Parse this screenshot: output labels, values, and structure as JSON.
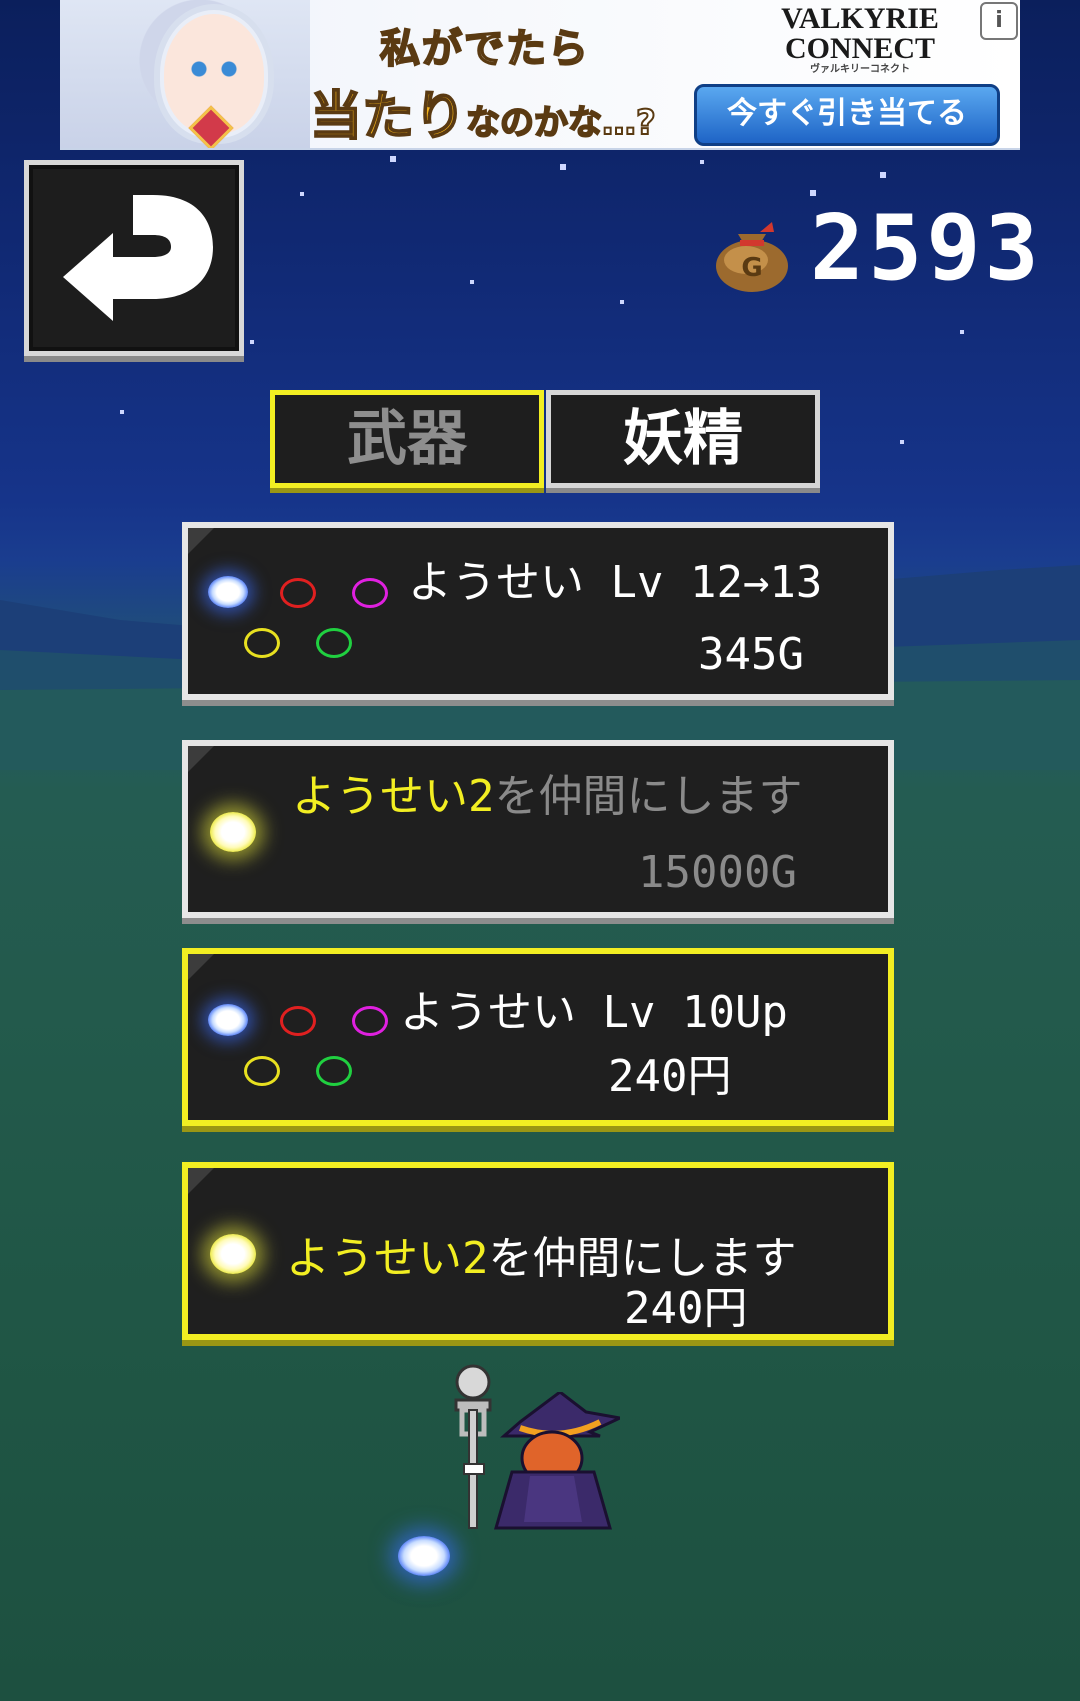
{
  "ad": {
    "headline_line1": "私がでたら",
    "headline_line2_big": "当たり",
    "headline_line2_small": "なのかな…?",
    "brand_line1": "VALKYRIE",
    "brand_line2": "CONNECT",
    "brand_kana": "ヴァルキリーコネクト",
    "cta_label": "今すぐ引き当てる",
    "info_icon": "i"
  },
  "header": {
    "back_icon": "return-arrow-icon",
    "gold_icon": "gold-bag-icon",
    "gold_amount": "2593"
  },
  "tabs": [
    {
      "label": "武器",
      "selected": false
    },
    {
      "label": "妖精",
      "selected": true
    }
  ],
  "items": [
    {
      "kind": "gold_upgrade",
      "orb_color": "blue",
      "rings": [
        "#e02020",
        "#e020e0",
        "#e8e020",
        "#20d040"
      ],
      "title": "ようせい Lv 12→13",
      "price": "345G"
    },
    {
      "kind": "gold_recruit",
      "orb_color": "yellow",
      "name": "ようせい2",
      "title_suffix": "を仲間にします",
      "price": "15000G",
      "affordable": false
    },
    {
      "kind": "paid_upgrade",
      "orb_color": "blue",
      "rings": [
        "#e02020",
        "#e020e0",
        "#e8e020",
        "#20d040"
      ],
      "title": "ようせい Lv 10Up",
      "price": "240円"
    },
    {
      "kind": "paid_recruit",
      "orb_color": "yellow",
      "name": "ようせい2",
      "title_suffix": "を仲間にします",
      "price": "240円"
    }
  ],
  "colors": {
    "accent_yellow": "#f2ee22",
    "card_bg": "#1f1f1f",
    "border_white": "#e6e6e6"
  }
}
